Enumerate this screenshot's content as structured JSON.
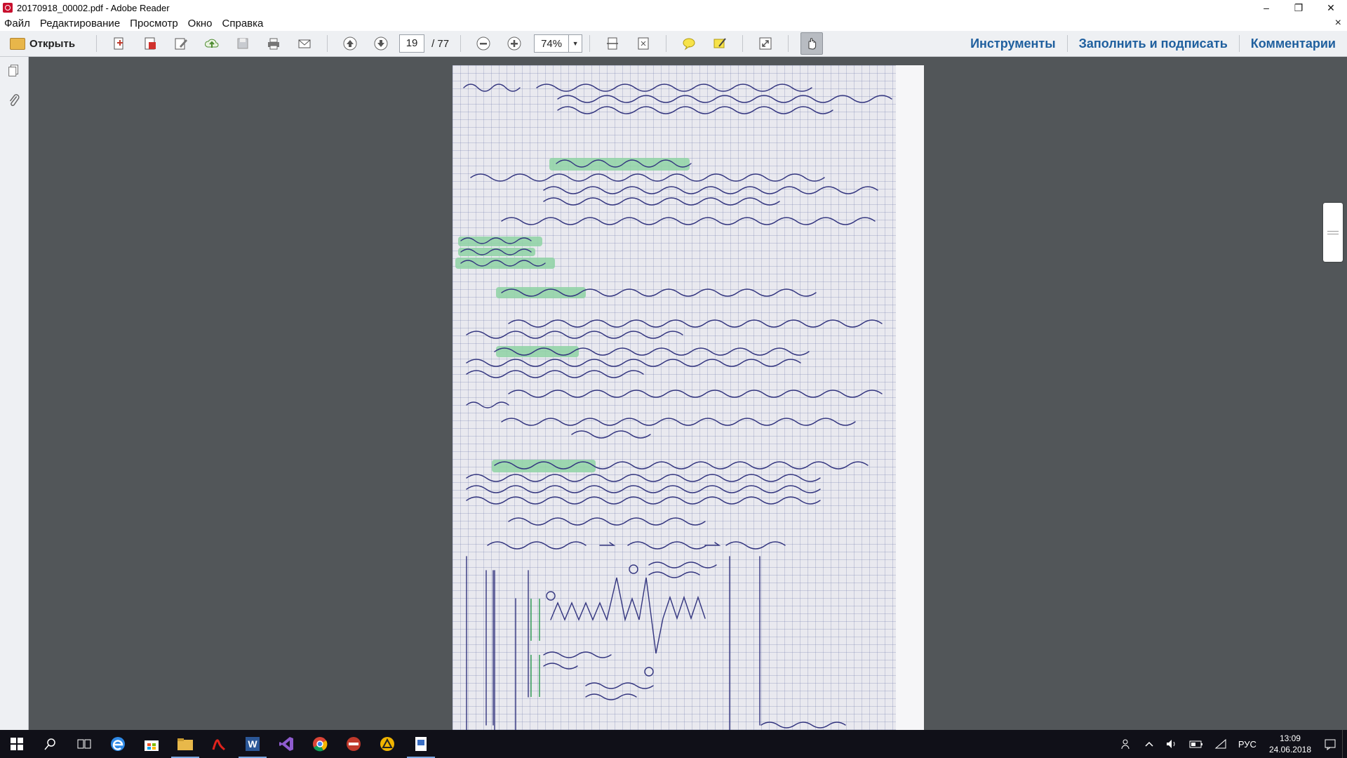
{
  "window": {
    "title": "20170918_00002.pdf - Adobe Reader",
    "minimize": "–",
    "restore": "❐",
    "close": "✕"
  },
  "menu": {
    "items": [
      "Файл",
      "Редактирование",
      "Просмотр",
      "Окно",
      "Справка"
    ],
    "close_doc": "×"
  },
  "toolbar": {
    "open_label": "Открыть",
    "page_current": "19",
    "page_total": "/ 77",
    "zoom": "74%",
    "links": [
      "Инструменты",
      "Заполнить и подписать",
      "Комментарии"
    ]
  },
  "icons": {
    "toolbar": [
      "create-pdf-icon",
      "convert-pdf-icon",
      "edit-icon",
      "upload-cloud-icon",
      "save-icon",
      "print-icon",
      "email-icon",
      "prev-page-icon",
      "next-page-icon",
      "zoom-out-icon",
      "zoom-in-icon",
      "fit-width-icon",
      "fit-page-icon",
      "comment-icon",
      "highlight-icon",
      "fullscreen-icon",
      "hand-tool-icon"
    ],
    "nav": [
      "pages-icon",
      "attachments-icon"
    ]
  },
  "taskbar": {
    "apps": [
      "start-icon",
      "search-icon",
      "task-view-icon",
      "edge-icon",
      "store-icon",
      "file-explorer-icon",
      "adobe-icon",
      "word-icon",
      "visual-studio-icon",
      "chrome-icon",
      "vpn-icon",
      "triangle-app-icon",
      "reader-doc-icon"
    ],
    "lang": "РУС",
    "time": "13:09",
    "date": "24.06.2018"
  },
  "colors": {
    "link": "#1f5f9e",
    "doc_bg": "#525659",
    "ink": "#2e2f7a",
    "highlight": "#8fd3a5"
  }
}
